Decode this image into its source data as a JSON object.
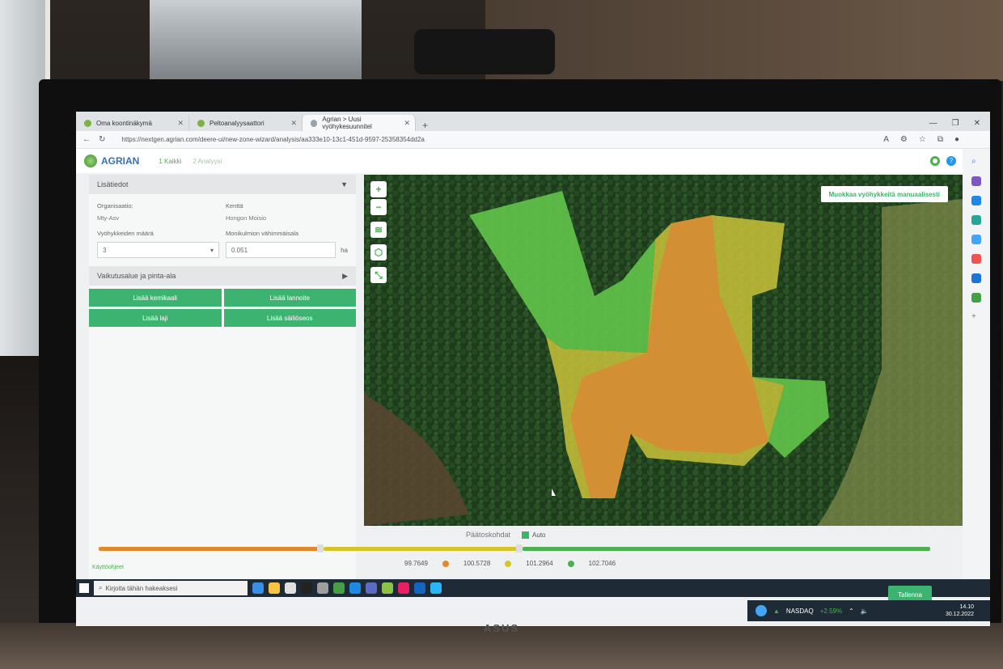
{
  "browser": {
    "tabs": [
      {
        "label": "Oma koontinäkymä"
      },
      {
        "label": "Peltoanalyysaattori"
      },
      {
        "label": "Agrian > Uusi vyöhykesuunnitel"
      }
    ],
    "url": "https://nextgen.agrian.com/deere-ui/new-zone-wizard/analysis/aa333e10-13c1-451d-9597-25358354dd2a"
  },
  "app": {
    "logo": "AGRIAN",
    "steps": [
      {
        "label": "1 Kaikki"
      },
      {
        "label": "2 Analyysi"
      }
    ]
  },
  "left_panel": {
    "details_header": "Lisätiedot",
    "org_label": "Organisaatio:",
    "org_value": "Mty-Asv",
    "field_label": "Kenttä",
    "field_value": "Hongon Moisio",
    "zone_count_label": "Vyöhykkeiden määrä",
    "zone_count_value": "3",
    "min_polygon_label": "Monikulmion vähimmäisala",
    "min_polygon_value": "0.051",
    "min_polygon_unit": "ha",
    "coverage_header": "Vaikutusalue ja pinta-ala",
    "buttons": {
      "add_chemical": "Lisää kemikaali",
      "add_fertilizer": "Lisää lannoite",
      "add_variety": "Lisää laji",
      "add_tank_mix": "Lisää säiliöseos"
    }
  },
  "map": {
    "manual_edit": "Muokkaa vyöhykkeitä manuaalisesti"
  },
  "thresholds": {
    "title": "Päätoskohdat",
    "auto_label": "Auto",
    "values": [
      "99.7649",
      "100.5728",
      "101.2964",
      "102.7046"
    ],
    "colors": [
      "#e08a2c",
      "#d6c32a",
      "#4caf50"
    ]
  },
  "footer": {
    "link": "Käyttöohjeet",
    "save": "Tallenna"
  },
  "taskbar": {
    "search_placeholder": "Kirjoita tähän hakeaksesi",
    "ticker": "NASDAQ",
    "ticker_change": "+2.59%",
    "time": "14.10",
    "date": "30.12.2022"
  }
}
